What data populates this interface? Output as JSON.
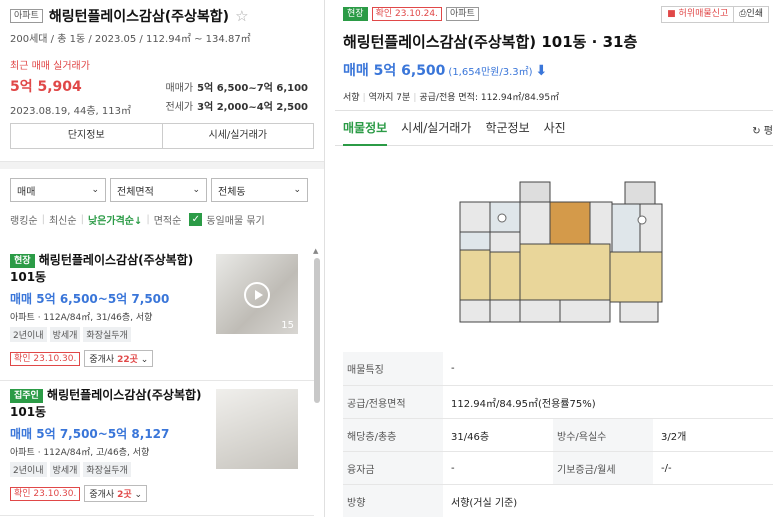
{
  "complex": {
    "tag": "아파트",
    "name": "해링턴플레이스감삼(주상복합)",
    "summary": "200세대 / 총 1동 / 2023.05 / 112.94㎡ ~ 134.87㎡",
    "recent_label": "최근 매매 실거래가",
    "recent_price": "5억 5,904",
    "recent_date": "2023.08.19, 44층, 113㎡",
    "sale_label": "매매가",
    "sale_range": "5억 6,500~7억 6,100",
    "jeonse_label": "전세가",
    "jeonse_range": "3억 2,000~4억 2,500",
    "tab_info": "단지정보",
    "tab_price": "시세/실거래가"
  },
  "filters": {
    "deal": "매매",
    "area": "전체면적",
    "building": "전체동"
  },
  "sort": {
    "ranking": "랭킹순",
    "recent": "최신순",
    "low_price": "낮은가격순↓",
    "area": "면적순",
    "same_group": "동일매물 묶기"
  },
  "listings": [
    {
      "tag": "현장",
      "title": "해링턴플레이스감삼(주상복합) 101동",
      "price": "매매 5억 6,500~5억 7,500",
      "info": "아파트 · 112A/84㎡, 31/46층, 서향",
      "chips": [
        "2년이내",
        "방세개",
        "화장실두개"
      ],
      "confirm": "확인 23.10.30.",
      "agents_prefix": "중개사 ",
      "agents_count": "22곳",
      "photo_count": "15"
    },
    {
      "tag": "집주인",
      "title": "해링턴플레이스감삼(주상복합) 101동",
      "price": "매매 5억 7,500~5억 8,127",
      "info": "아파트 · 112A/84㎡, 고/46층, 서향",
      "chips": [
        "2년이내",
        "방세개",
        "화장실두개"
      ],
      "confirm": "확인 23.10.30.",
      "agents_prefix": "중개사 ",
      "agents_count": "2곳"
    }
  ],
  "detail": {
    "tag_site": "현장",
    "confirm": "확인 23.10.24.",
    "tag_type": "아파트",
    "report": "허위매물신고",
    "print": "인쇄",
    "title": "해링턴플레이스감삼(주상복합) 101동 · 31층",
    "price": "매매 5억 6,500",
    "price_sub": "(1,654만원/3.3㎡)",
    "meta": [
      "서향",
      "역까지 7분",
      "공급/전용 면적: 112.94㎡/84.95㎡"
    ],
    "tabs": [
      "매물정보",
      "시세/실거래가",
      "학군정보",
      "사진"
    ],
    "refresh": "평",
    "rows": {
      "feature_k": "매물특징",
      "feature_v": "-",
      "area_k": "공급/전용면적",
      "area_v": "112.94㎡/84.95㎡(전용률75%)",
      "floor_k": "해당층/총층",
      "floor_v": "31/46층",
      "rooms_k": "방수/욕실수",
      "rooms_v": "3/2개",
      "loan_k": "융자금",
      "loan_v": "-",
      "deposit_k": "기보증금/월세",
      "deposit_v": "-/-",
      "direction_k": "방향",
      "direction_v": "서향(거실 기준)"
    }
  },
  "colors": {
    "green": "#2b9b46",
    "blue": "#3a76d9",
    "red": "#e04848"
  }
}
